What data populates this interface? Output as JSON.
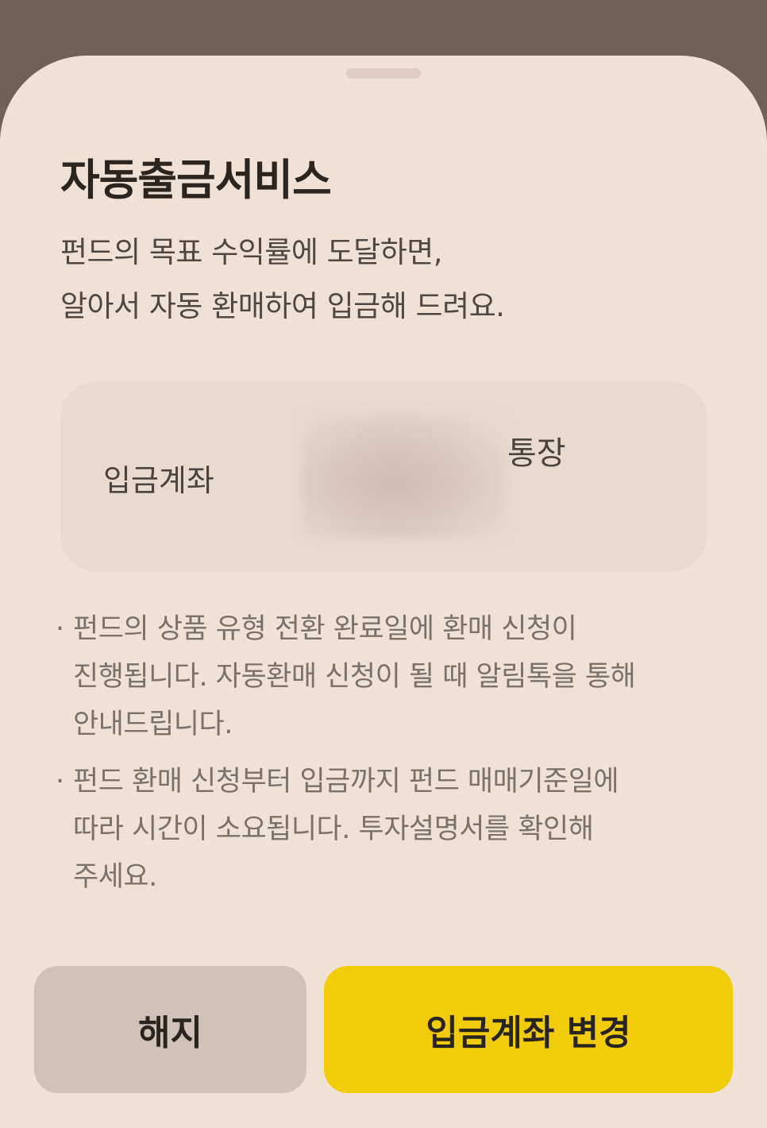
{
  "sheet": {
    "title": "자동출금서비스",
    "description": [
      "펀드의 목표 수익률에 도달하면,",
      "알아서 자동 환매하여 입금해 드려요."
    ]
  },
  "account": {
    "label": "입금계좌",
    "suffix": "통장"
  },
  "notes": [
    {
      "bullet": "·",
      "lines": [
        "펀드의 상품 유형 전환 완료일에 환매 신청이",
        "진행됩니다. 자동환매 신청이 될 때 알림톡을 통해",
        "안내드립니다."
      ]
    },
    {
      "bullet": "·",
      "lines": [
        "펀드 환매 신청부터 입금까지 펀드 매매기준일에",
        "따라 시간이 소요됩니다. 투자설명서를 확인해",
        "주세요."
      ]
    }
  ],
  "buttons": {
    "cancel_label": "해지",
    "change_label": "입금계좌 변경"
  },
  "colors": {
    "backdrop": "#6f6157",
    "sheet": "#efe1d6",
    "primary_button": "#f0cc0a",
    "secondary_button": "#d0c2b8"
  }
}
